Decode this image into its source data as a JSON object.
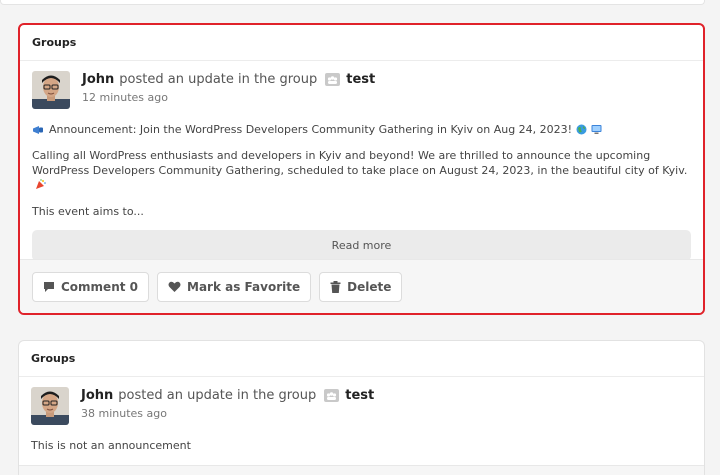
{
  "colors": {
    "highlight_border": "#e0222a",
    "button_bg": "#ebebeb",
    "text": "#444444"
  },
  "posts": [
    {
      "section_title": "Groups",
      "author": "John",
      "action_text": "posted an update in the group",
      "group_icon": "group-icon",
      "group_name": "test",
      "timestamp": "12 minutes ago",
      "announcement": "Announcement: Join the WordPress Developers Community Gathering in Kyiv on Aug 24, 2023!",
      "paragraph": "Calling all WordPress enthusiasts and developers in Kyiv and beyond! We are thrilled to announce the upcoming WordPress Developers Community Gathering, scheduled to take place on August 24, 2023, in the beautiful city of Kyiv.",
      "excerpt_end": "This event aims to...",
      "read_more": "Read more",
      "actions": {
        "comment_label": "Comment 0",
        "favorite_label": "Mark as Favorite",
        "delete_label": "Delete"
      }
    },
    {
      "section_title": "Groups",
      "author": "John",
      "action_text": "posted an update in the group",
      "group_icon": "group-icon",
      "group_name": "test",
      "timestamp": "38 minutes ago",
      "content": "This is not an announcement"
    }
  ]
}
